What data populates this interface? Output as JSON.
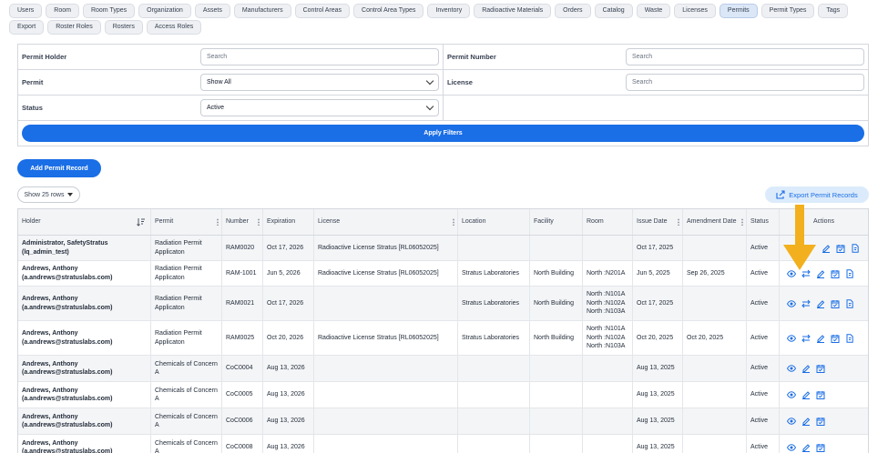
{
  "tabs": [
    "Users",
    "Room",
    "Room Types",
    "Organization",
    "Assets",
    "Manufacturers",
    "Control Areas",
    "Control Area Types",
    "Inventory",
    "Radioactive Materials",
    "Orders",
    "Catalog",
    "Waste",
    "Licenses",
    "Permits",
    "Permit Types",
    "Tags",
    "Export",
    "Roster Roles",
    "Rosters",
    "Access Roles"
  ],
  "active_tab": "Permits",
  "filters": {
    "permit_holder_label": "Permit Holder",
    "permit_holder_placeholder": "Search",
    "permit_number_label": "Permit Number",
    "permit_number_placeholder": "Search",
    "permit_label": "Permit",
    "permit_value": "Show All",
    "license_label": "License",
    "license_placeholder": "Search",
    "status_label": "Status",
    "status_value": "Active",
    "apply_label": "Apply Filters"
  },
  "add_permit_label": "Add Permit Record",
  "rows_select_label": "Show 25 rows",
  "export_label": "Export Permit Records",
  "table": {
    "headers": {
      "holder": "Holder",
      "permit": "Permit",
      "number": "Number",
      "expiration": "Expiration",
      "license": "License",
      "location": "Location",
      "facility": "Facility",
      "room": "Room",
      "issue_date": "Issue Date",
      "amendment_date": "Amendment Date",
      "status": "Status",
      "actions": "Actions"
    },
    "rows": [
      {
        "holder": "Administrator, SafetyStratus (lq_admin_test)",
        "permit": "Radiation Permit Applicaton",
        "number": "RAM0020",
        "expiration": "Oct 17, 2026",
        "license": "Radioactive License Stratus [RL06052025]",
        "location": "",
        "facility": "",
        "room": "",
        "issue_date": "Oct 17, 2025",
        "amendment_date": "",
        "status": "Active"
      },
      {
        "holder": "Andrews, Anthony (a.andrews@stratuslabs.com)",
        "permit": "Radiation Permit Applicaton",
        "number": "RAM-1001",
        "expiration": "Jun 5, 2026",
        "license": "Radioactive License Stratus [RL06052025]",
        "location": "Stratus Laboratories",
        "facility": "North Building",
        "room": "North :N201A",
        "issue_date": "Jun 5, 2025",
        "amendment_date": "Sep 26, 2025",
        "status": "Active"
      },
      {
        "holder": "Andrews, Anthony (a.andrews@stratuslabs.com)",
        "permit": "Radiation Permit Applicaton",
        "number": "RAM0021",
        "expiration": "Oct 17, 2026",
        "license": "",
        "location": "Stratus Laboratories",
        "facility": "North Building",
        "room": "North :N101A North :N102A North :N103A",
        "issue_date": "Oct 17, 2025",
        "amendment_date": "",
        "status": "Active"
      },
      {
        "holder": "Andrews, Anthony (a.andrews@stratuslabs.com)",
        "permit": "Radiation Permit Applicaton",
        "number": "RAM0025",
        "expiration": "Oct 20, 2026",
        "license": "Radioactive License Stratus [RL06052025]",
        "location": "Stratus Laboratories",
        "facility": "North Building",
        "room": "North :N101A North :N102A North :N103A",
        "issue_date": "Oct 20, 2025",
        "amendment_date": "Oct 20, 2025",
        "status": "Active"
      },
      {
        "holder": "Andrews, Anthony (a.andrews@stratuslabs.com)",
        "permit": "Chemicals of Concern A",
        "number": "CoC0004",
        "expiration": "Aug 13, 2026",
        "license": "",
        "location": "",
        "facility": "",
        "room": "",
        "issue_date": "Aug 13, 2025",
        "amendment_date": "",
        "status": "Active"
      },
      {
        "holder": "Andrews, Anthony (a.andrews@stratuslabs.com)",
        "permit": "Chemicals of Concern A",
        "number": "CoC0005",
        "expiration": "Aug 13, 2026",
        "license": "",
        "location": "",
        "facility": "",
        "room": "",
        "issue_date": "Aug 13, 2025",
        "amendment_date": "",
        "status": "Active"
      },
      {
        "holder": "Andrews, Anthony (a.andrews@stratuslabs.com)",
        "permit": "Chemicals of Concern A",
        "number": "CoC0006",
        "expiration": "Aug 13, 2026",
        "license": "",
        "location": "",
        "facility": "",
        "room": "",
        "issue_date": "Aug 13, 2025",
        "amendment_date": "",
        "status": "Active"
      },
      {
        "holder": "Andrews, Anthony (a.andrews@stratuslabs.com)",
        "permit": "Chemicals of Concern A",
        "number": "CoC0008",
        "expiration": "Aug 13, 2026",
        "license": "",
        "location": "",
        "facility": "",
        "room": "",
        "issue_date": "Aug 13, 2025",
        "amendment_date": "",
        "status": "Active"
      }
    ]
  },
  "colors": {
    "primary": "#1a6ee6",
    "export_bg": "#dcebfb",
    "arrow": "#f2b01e"
  },
  "icons": [
    "eye-icon",
    "transfer-icon",
    "edit-icon",
    "calendar-icon",
    "document-icon"
  ]
}
